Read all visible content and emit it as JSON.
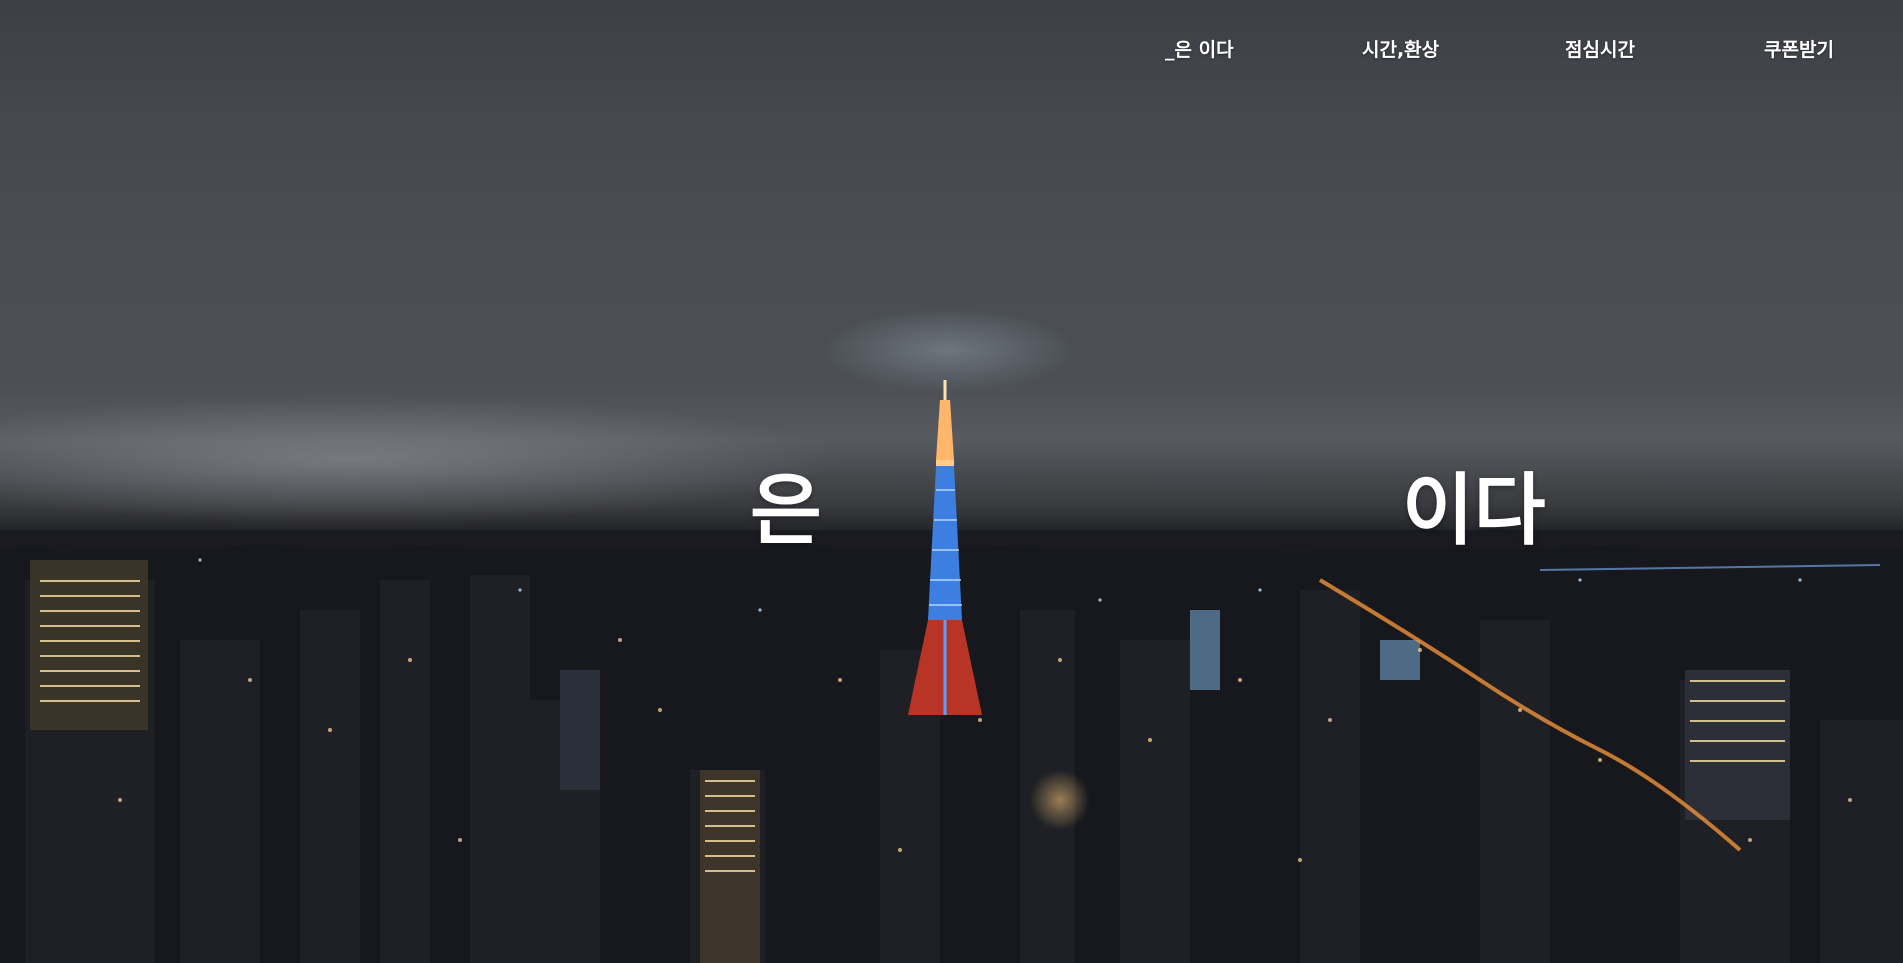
{
  "nav": {
    "items": [
      {
        "label": "_은 이다"
      },
      {
        "label": "시간,환상"
      },
      {
        "label": "점심시간"
      },
      {
        "label": "쿠폰받기"
      }
    ]
  },
  "hero": {
    "word_left": "은",
    "word_right": "이다"
  },
  "colors": {
    "text": "#ffffff",
    "sky": "#4a4e54",
    "city_dark": "#0e0f13",
    "tower_blue": "#4a8fe8",
    "tower_red": "#c83a2a"
  }
}
